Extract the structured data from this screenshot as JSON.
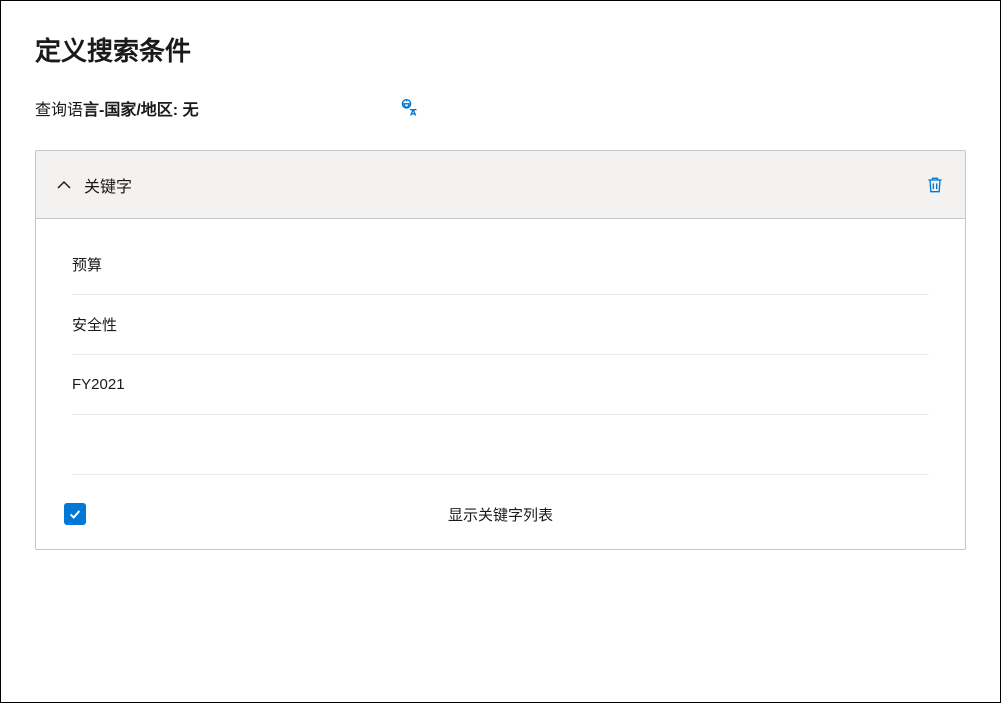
{
  "page_title": "定义搜索条件",
  "query_language": {
    "label_part1": "查询语",
    "label_part2_bold": "言-国家/地区: 无"
  },
  "keywords_section": {
    "title": "关键字",
    "items": [
      "预算",
      "安全性",
      "FY2021"
    ],
    "show_list_label": "显示关键字列表",
    "show_list_checked": true
  }
}
